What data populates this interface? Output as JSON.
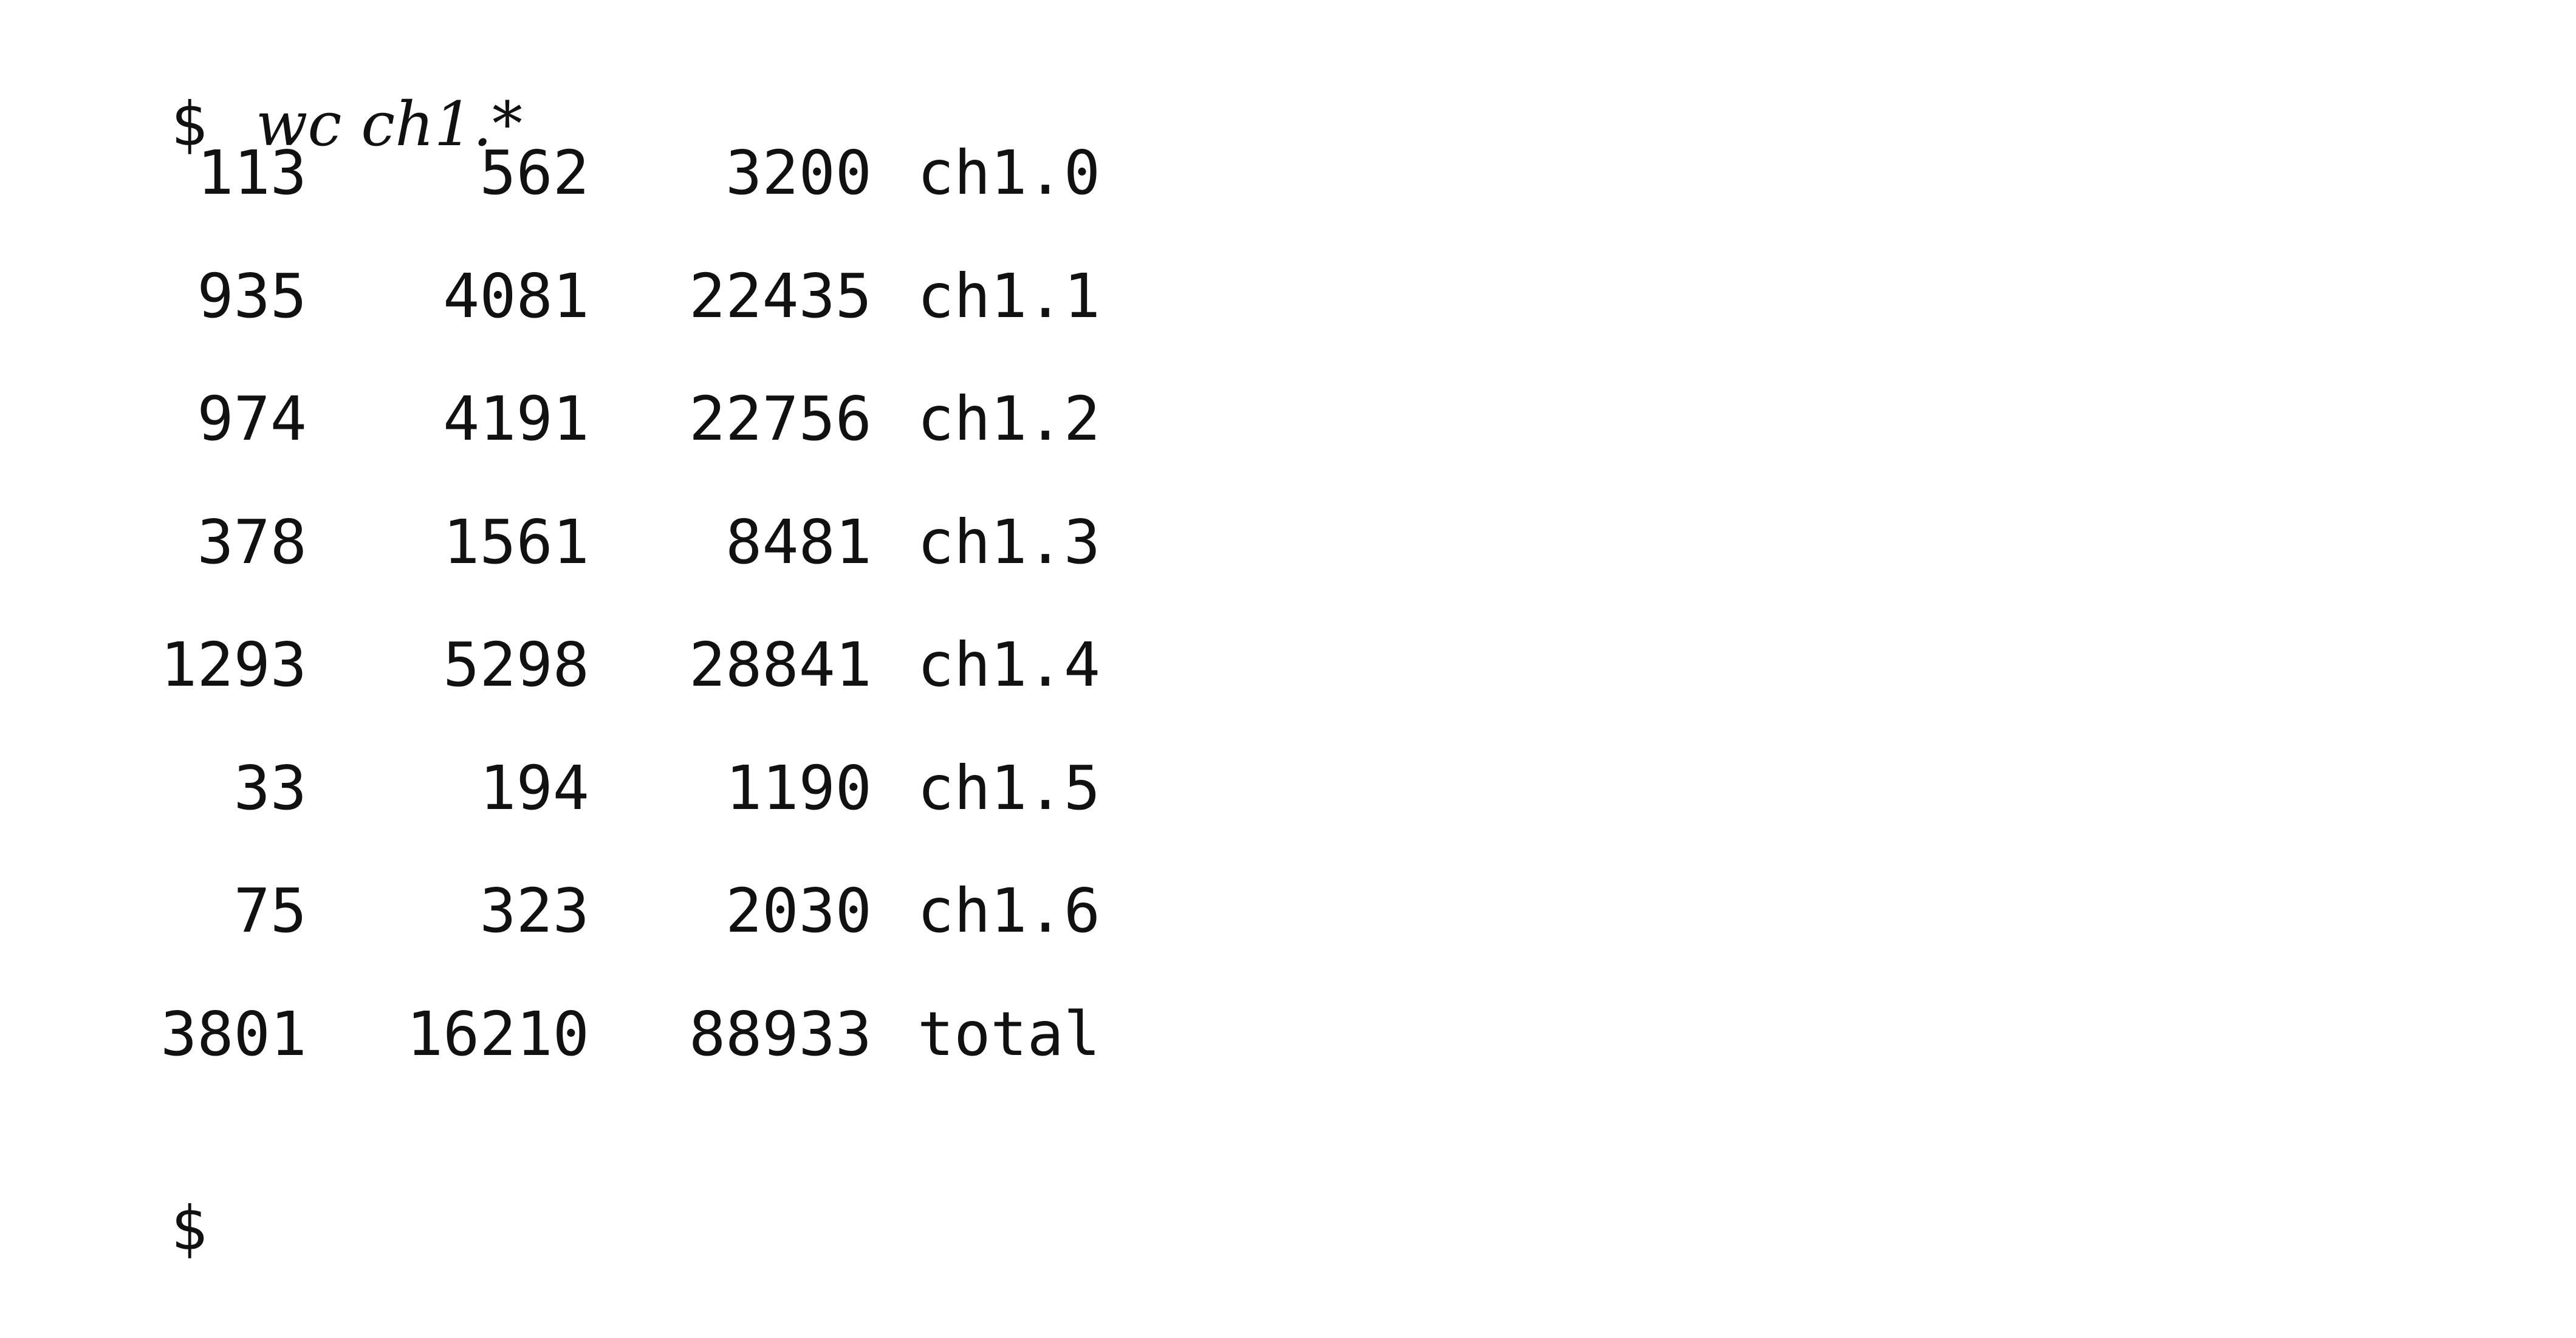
{
  "terminal": {
    "prompt": "$",
    "command": "wc ch1.*",
    "rows": [
      {
        "lines": "113",
        "words": "562",
        "chars": "3200",
        "file": "ch1.0"
      },
      {
        "lines": "935",
        "words": "4081",
        "chars": "22435",
        "file": "ch1.1"
      },
      {
        "lines": "974",
        "words": "4191",
        "chars": "22756",
        "file": "ch1.2"
      },
      {
        "lines": "378",
        "words": "1561",
        "chars": "8481",
        "file": "ch1.3"
      },
      {
        "lines": "1293",
        "words": "5298",
        "chars": "28841",
        "file": "ch1.4"
      },
      {
        "lines": "33",
        "words": "194",
        "chars": "1190",
        "file": "ch1.5"
      },
      {
        "lines": "75",
        "words": "323",
        "chars": "2030",
        "file": "ch1.6"
      },
      {
        "lines": "3801",
        "words": "16210",
        "chars": "88933",
        "file": "total"
      }
    ],
    "final_prompt": "$"
  }
}
